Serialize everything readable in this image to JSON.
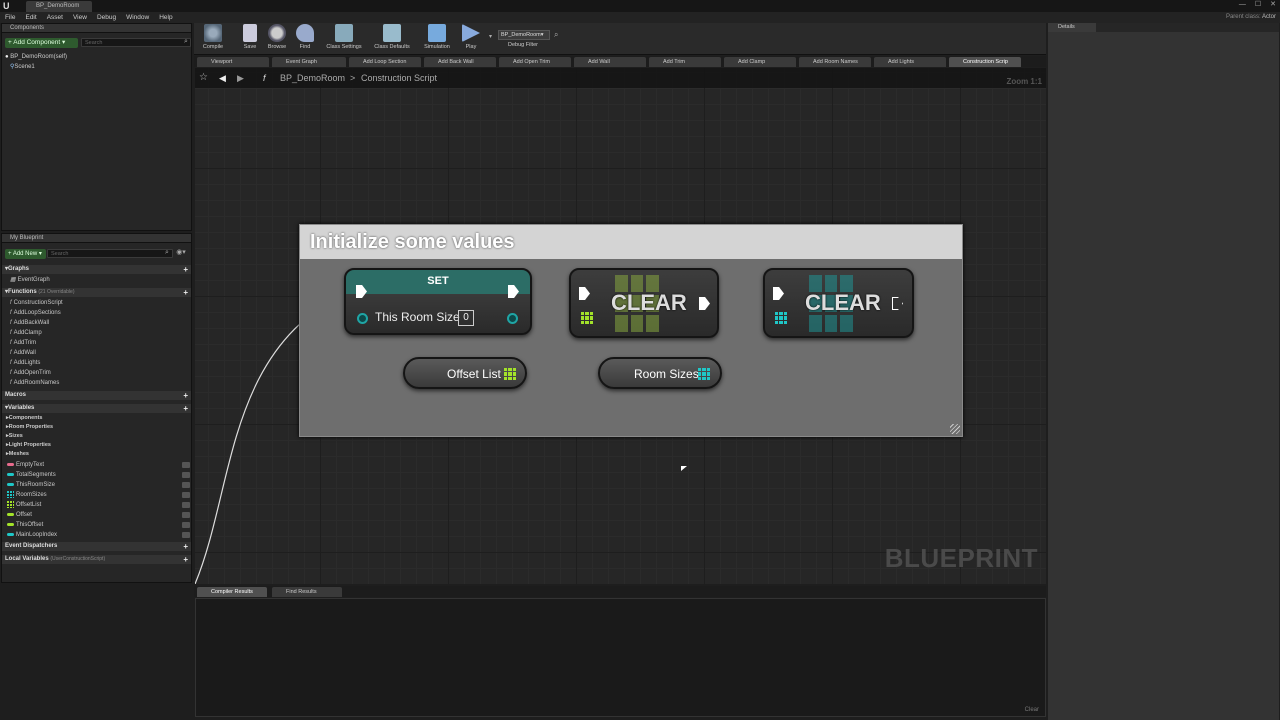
{
  "window": {
    "tab": "BP_DemoRoom",
    "parent_class_label": "Parent class:",
    "parent_class": "Actor"
  },
  "menu": [
    "File",
    "Edit",
    "Asset",
    "View",
    "Debug",
    "Window",
    "Help"
  ],
  "components": {
    "tab": "Components",
    "add_label": "+ Add Component ▾",
    "search_placeholder": "Search",
    "root": "BP_DemoRoom(self)",
    "child": "Scene1"
  },
  "myblueprint": {
    "tab": "My Blueprint",
    "add_label": "+ Add New ▾",
    "search_placeholder": "Search",
    "graphs_header": "Graphs",
    "graphs": [
      "EventGraph"
    ],
    "functions_header": "Functions",
    "functions_overridable": "(21 Overridable)",
    "functions": [
      "ConstructionScript",
      "AddLoopSections",
      "AddBackWall",
      "AddClamp",
      "AddTrim",
      "AddWall",
      "AddLights",
      "AddOpenTrim",
      "AddRoomNames"
    ],
    "macros_header": "Macros",
    "variables_header": "Variables",
    "var_categories": [
      "Components",
      "Room Properties",
      "Sizes",
      "Light Properties",
      "Meshes"
    ],
    "variables": [
      {
        "name": "EmptyText",
        "color": "#e86b8d",
        "kind": "dot"
      },
      {
        "name": "TotalSegments",
        "color": "#1fc7c7",
        "kind": "dot"
      },
      {
        "name": "ThisRoomSize",
        "color": "#1fc7c7",
        "kind": "dot"
      },
      {
        "name": "RoomSizes",
        "color": "#1fc7c7",
        "kind": "grid"
      },
      {
        "name": "OffsetList",
        "color": "#a3e22a",
        "kind": "grid"
      },
      {
        "name": "Offset",
        "color": "#a3e22a",
        "kind": "dot"
      },
      {
        "name": "ThisOffset",
        "color": "#a3e22a",
        "kind": "dot"
      },
      {
        "name": "MainLoopIndex",
        "color": "#1fc7c7",
        "kind": "dot"
      }
    ],
    "dispatchers_header": "Event Dispatchers",
    "locals_header": "Local Variables",
    "locals_scope": "(UserConstructionScript)"
  },
  "toolbar": {
    "compile": "Compile",
    "save": "Save",
    "browse": "Browse",
    "find": "Find",
    "class_settings": "Class Settings",
    "class_defaults": "Class Defaults",
    "simulation": "Simulation",
    "play": "Play",
    "debug_object": "BP_DemoRoom▾",
    "debug_filter": "Debug Filter"
  },
  "tabs": [
    "Viewport",
    "Event Graph",
    "Add Loop Section",
    "Add Back Wall",
    "Add Open Trim",
    "Add Wall",
    "Add Trim",
    "Add Clamp",
    "Add Room Names",
    "Add Lights",
    "Construction Scrip"
  ],
  "breadcrumb": {
    "root": "BP_DemoRoom",
    "separator": ">",
    "current": "Construction Script"
  },
  "graph": {
    "zoom": "Zoom 1:1",
    "watermark": "BLUEPRINT",
    "comment": "Initialize some values",
    "set_node": {
      "title": "SET",
      "var": "This Room Size",
      "value": "0"
    },
    "clear_label": "CLEAR",
    "offset_var": "Offset List",
    "room_sizes_var": "Room Sizes",
    "colors": {
      "int": "#1fc7c7",
      "vector": "#a3e22a",
      "exec": "#ffffff"
    }
  },
  "bottom": {
    "tabs": [
      "Compiler Results",
      "Find Results"
    ],
    "clear": "Clear"
  },
  "details": {
    "tab": "Details"
  }
}
